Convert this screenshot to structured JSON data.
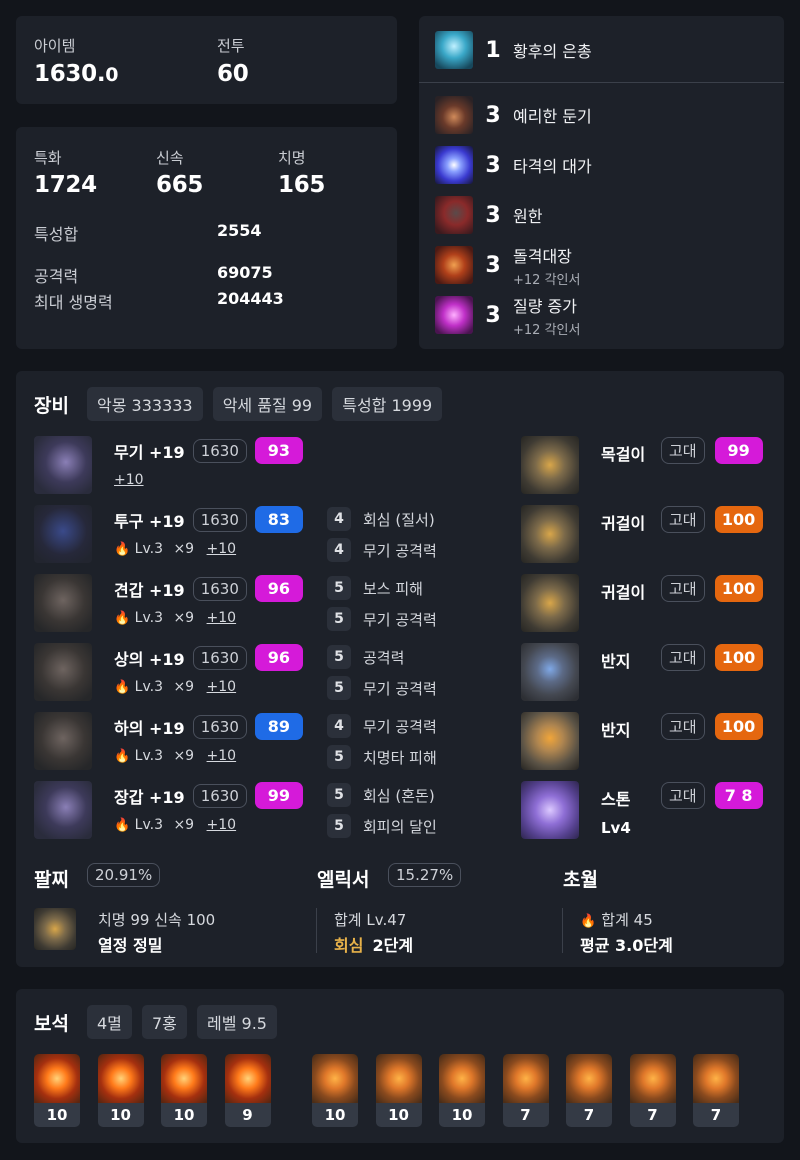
{
  "summary": {
    "item_level_label": "아이템",
    "item_level_main": "1630.",
    "item_level_decimal": "0",
    "combat_label": "전투",
    "combat_value": "60"
  },
  "stats": {
    "crit_label": "특화",
    "crit_value": "1724",
    "swift_label": "신속",
    "swift_value": "665",
    "critical_label": "치명",
    "critical_value": "165",
    "total_label": "특성합",
    "total_value": "2554",
    "attack_label": "공격력",
    "attack_value": "69075",
    "hp_label": "최대 생명력",
    "hp_value": "204443"
  },
  "engravings": [
    {
      "icon": "empress-grace-icon",
      "level": "1",
      "name": "황후의 은총",
      "sub": ""
    },
    {
      "icon": "keen-blunt-icon",
      "level": "3",
      "name": "예리한 둔기",
      "sub": ""
    },
    {
      "icon": "hit-master-icon",
      "level": "3",
      "name": "타격의 대가",
      "sub": ""
    },
    {
      "icon": "grudge-icon",
      "level": "3",
      "name": "원한",
      "sub": ""
    },
    {
      "icon": "raid-captain-icon",
      "level": "3",
      "name": "돌격대장",
      "sub": "+12 각인서"
    },
    {
      "icon": "mass-increase-icon",
      "level": "3",
      "name": "질량 증가",
      "sub": "+12 각인서"
    }
  ],
  "equipment": {
    "title": "장비",
    "tags": [
      "악몽 333333",
      "악세 품질 99",
      "특성합 1999"
    ],
    "gear": [
      {
        "icon": "weapon-icon",
        "name": "무기 +19",
        "ilvl": "1630",
        "quality": "93",
        "qcolor": "#d51ad9",
        "sub_level": "",
        "sub_count": "",
        "sub_plus": "+10",
        "opts": []
      },
      {
        "icon": "helmet-icon",
        "name": "투구 +19",
        "ilvl": "1630",
        "quality": "83",
        "qcolor": "#1f6be6",
        "sub_level": "Lv.3",
        "sub_count": "×9",
        "sub_plus": "+10",
        "opts": [
          {
            "n": "4",
            "t": "회심 (질서)"
          },
          {
            "n": "4",
            "t": "무기 공격력"
          }
        ]
      },
      {
        "icon": "shoulder-icon",
        "name": "견갑 +19",
        "ilvl": "1630",
        "quality": "96",
        "qcolor": "#d51ad9",
        "sub_level": "Lv.3",
        "sub_count": "×9",
        "sub_plus": "+10",
        "opts": [
          {
            "n": "5",
            "t": "보스 피해"
          },
          {
            "n": "5",
            "t": "무기 공격력"
          }
        ]
      },
      {
        "icon": "chest-icon",
        "name": "상의 +19",
        "ilvl": "1630",
        "quality": "96",
        "qcolor": "#d51ad9",
        "sub_level": "Lv.3",
        "sub_count": "×9",
        "sub_plus": "+10",
        "opts": [
          {
            "n": "5",
            "t": "공격력"
          },
          {
            "n": "5",
            "t": "무기 공격력"
          }
        ]
      },
      {
        "icon": "pants-icon",
        "name": "하의 +19",
        "ilvl": "1630",
        "quality": "89",
        "qcolor": "#1f6be6",
        "sub_level": "Lv.3",
        "sub_count": "×9",
        "sub_plus": "+10",
        "opts": [
          {
            "n": "4",
            "t": "무기 공격력"
          },
          {
            "n": "5",
            "t": "치명타 피해"
          }
        ]
      },
      {
        "icon": "gloves-icon",
        "name": "장갑 +19",
        "ilvl": "1630",
        "quality": "99",
        "qcolor": "#d51ad9",
        "sub_level": "Lv.3",
        "sub_count": "×9",
        "sub_plus": "+10",
        "opts": [
          {
            "n": "5",
            "t": "회심 (혼돈)"
          },
          {
            "n": "5",
            "t": "회피의 달인"
          }
        ]
      }
    ],
    "accessories": [
      {
        "icon": "necklace-icon",
        "name": "목걸이",
        "grade": "고대",
        "quality": "99",
        "qcolor": "#d51ad9"
      },
      {
        "icon": "earring-icon",
        "name": "귀걸이",
        "grade": "고대",
        "quality": "100",
        "qcolor": "#e5670f"
      },
      {
        "icon": "earring-icon",
        "name": "귀걸이",
        "grade": "고대",
        "quality": "100",
        "qcolor": "#e5670f"
      },
      {
        "icon": "ring-icon",
        "name": "반지",
        "grade": "고대",
        "quality": "100",
        "qcolor": "#e5670f"
      },
      {
        "icon": "ring-icon",
        "name": "반지",
        "grade": "고대",
        "quality": "100",
        "qcolor": "#e5670f"
      },
      {
        "icon": "stone-icon",
        "name": "스톤",
        "grade": "고대",
        "quality": "7 8",
        "qcolor": "#d51ad9",
        "sub": "Lv4"
      }
    ],
    "bracelet": {
      "title": "팔찌",
      "pct": "20.91%",
      "line1": "치명 99  신속 100",
      "line2": "열정  정밀"
    },
    "elixir": {
      "title": "엘릭서",
      "pct": "15.27%",
      "line1": "합계 Lv.47",
      "line2_hl": "회심",
      "line2": "2단계"
    },
    "transcend": {
      "title": "초월",
      "line1": "합계 45",
      "line2": "평균 3.0단계"
    }
  },
  "gems": {
    "title": "보석",
    "tags": [
      "4멸",
      "7홍",
      "레벨 9.5"
    ],
    "items": [
      {
        "type": "red",
        "level": "10"
      },
      {
        "type": "red",
        "level": "10"
      },
      {
        "type": "red",
        "level": "10"
      },
      {
        "type": "red",
        "level": "9"
      },
      {
        "type": "amb",
        "level": "10"
      },
      {
        "type": "amb",
        "level": "10"
      },
      {
        "type": "amb",
        "level": "10"
      },
      {
        "type": "amb",
        "level": "7"
      },
      {
        "type": "amb",
        "level": "7"
      },
      {
        "type": "amb",
        "level": "7"
      },
      {
        "type": "amb",
        "level": "7"
      }
    ]
  }
}
